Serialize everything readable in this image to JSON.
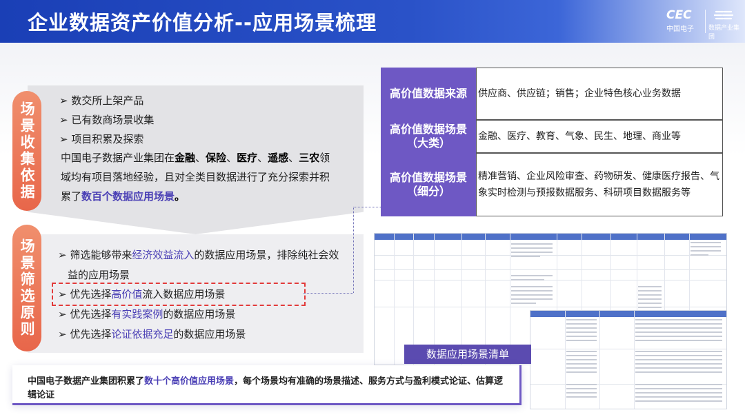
{
  "header": {
    "title": "企业数据资产价值分析--应用场景梳理",
    "logo_cec": "CEC",
    "logo_cec_sub": "中国电子",
    "logo_group_sub": "数据产业集团"
  },
  "collect": {
    "pill": "场景收集依据",
    "bullets": [
      "➢ 数交所上架产品",
      "➢ 已有数商场景收集",
      "➢ 项目积累及探索"
    ],
    "para": {
      "l1_pre": "中国电子数据产业集团在",
      "l1_bold1": "金融",
      "sep1": "、",
      "l1_bold2": "保险",
      "sep2": "、",
      "l1_bold3": "医疗",
      "sep3": "、",
      "l1_bold4": "遥感",
      "sep4": "、",
      "l1_bold5": "三农",
      "l1_post": "领",
      "l2": "域均有项目落地经验，且对全类目数据进行了充分探索并积",
      "l3_pre": "累了",
      "l3_hl": "数百个数据应用场景",
      "l3_post": "。"
    }
  },
  "filter": {
    "pill": "场景筛选原则",
    "items": [
      {
        "pre": "➢ 筛选能够带来",
        "hl": "经济效益流入",
        "post": "的数据应用场景，排除纯社会效"
      },
      {
        "pre": "",
        "hl": "",
        "post": "益的应用场景"
      },
      {
        "pre": "➢ 优先选择",
        "hl": "高价值",
        "post": "流入数据应用场景"
      },
      {
        "pre": "➢ 优先选择",
        "hl": "有实践案例",
        "post": "的数据应用场景"
      },
      {
        "pre": "➢ 优先选择",
        "hl": "论证依据充足",
        "post": "的数据应用场景"
      }
    ]
  },
  "table": {
    "rows": [
      {
        "label": "高价值数据来源",
        "value": "供应商、供应链；销售；企业特色核心业务数据"
      },
      {
        "label": "高价值数据场景\n（大类）",
        "value": "金融、医疗、教育、气象、民生、地理、商业等"
      },
      {
        "label": "高价值数据场景\n（细分）",
        "value": "精准营销、企业风险审查、药物研发、健康医疗报告、气象实时检测与预报数据服务、科研项目数据服务等"
      }
    ]
  },
  "list_caption": "数据应用场景清单",
  "bottom": {
    "pre": "中国电子数据产业集团积累了",
    "hl": "数十个高价值应用场景",
    "post": "，每个场景均有准确的场景描述、服务方式与盈利模式论证、估算逻辑论证"
  },
  "colors": {
    "header_blue": "#1a3fb6",
    "accent_purple": "#6e58c4",
    "pill_orange": "#e8664a",
    "highlight": "#4a3fb5",
    "dash_red": "#e23a3a"
  }
}
